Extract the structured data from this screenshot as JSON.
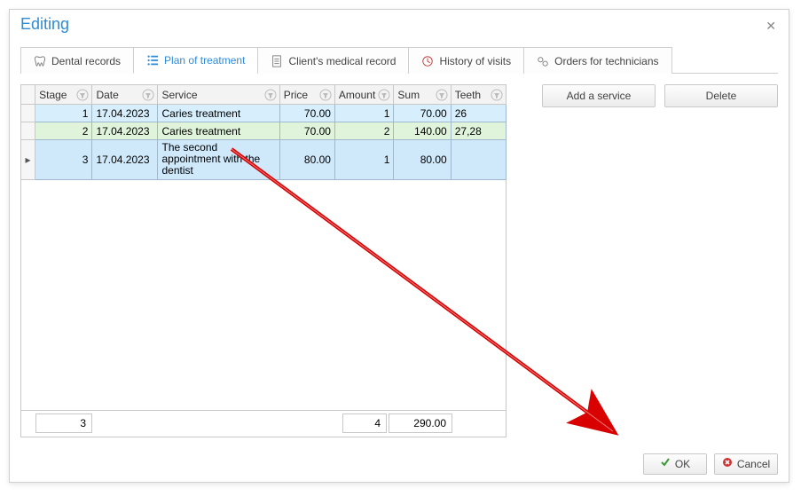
{
  "dialog": {
    "title": "Editing"
  },
  "tabs": {
    "dental": "Dental records",
    "plan": "Plan of treatment",
    "medrec": "Client's medical record",
    "history": "History of visits",
    "orders": "Orders for technicians"
  },
  "buttons": {
    "add_service": "Add a service",
    "delete": "Delete",
    "ok": "OK",
    "cancel": "Cancel"
  },
  "grid": {
    "headers": {
      "stage": "Stage",
      "date": "Date",
      "service": "Service",
      "price": "Price",
      "amount": "Amount",
      "sum": "Sum",
      "teeth": "Teeth"
    },
    "rows": [
      {
        "stage": "1",
        "date": "17.04.2023",
        "service": "Caries treatment",
        "price": "70.00",
        "amount": "1",
        "sum": "70.00",
        "teeth": "26"
      },
      {
        "stage": "2",
        "date": "17.04.2023",
        "service": "Caries treatment",
        "price": "70.00",
        "amount": "2",
        "sum": "140.00",
        "teeth": "27,28"
      },
      {
        "stage": "3",
        "date": "17.04.2023",
        "service": "The second appointment with the dentist",
        "price": "80.00",
        "amount": "1",
        "sum": "80.00",
        "teeth": ""
      }
    ],
    "summary": {
      "stage_total": "3",
      "amount_total": "4",
      "sum_total": "290.00"
    }
  }
}
